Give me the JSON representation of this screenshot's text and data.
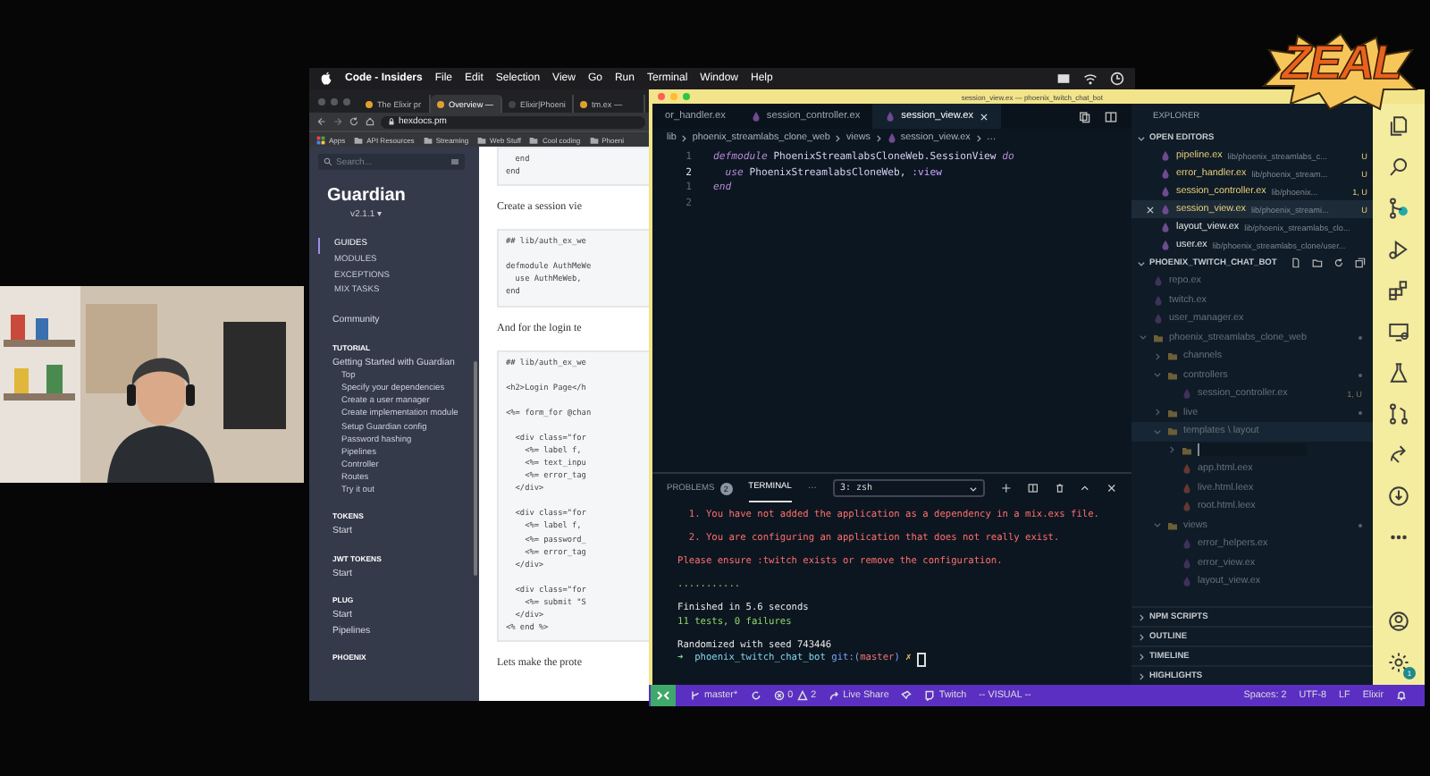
{
  "menu_bar": {
    "app": "Code - Insiders",
    "items": [
      "File",
      "Edit",
      "Selection",
      "View",
      "Go",
      "Run",
      "Terminal",
      "Window",
      "Help"
    ]
  },
  "logo": {
    "text": "ZEAL"
  },
  "browser": {
    "tabs": [
      {
        "title": "The Elixir pr",
        "selected": false
      },
      {
        "title": "Overview —",
        "selected": true
      },
      {
        "title": "Elixir|Phoeni",
        "selected": false
      },
      {
        "title": "tm.ex —",
        "selected": false
      }
    ],
    "url": "hexdocs.pm",
    "bookmarks": [
      {
        "label": "Apps",
        "kind": "apps"
      },
      {
        "label": "API Resources",
        "kind": "folder"
      },
      {
        "label": "Streaming",
        "kind": "folder"
      },
      {
        "label": "Web Stuff",
        "kind": "folder"
      },
      {
        "label": "Cool coding",
        "kind": "folder"
      },
      {
        "label": "Phoeni",
        "kind": "folder"
      }
    ],
    "sidebar": {
      "search_placeholder": "Search...",
      "title": "Guardian",
      "version": "v2.1.1 ▾",
      "nav": [
        {
          "label": "GUIDES",
          "selected": true
        },
        {
          "label": "MODULES",
          "selected": false
        },
        {
          "label": "EXCEPTIONS",
          "selected": false
        },
        {
          "label": "MIX TASKS",
          "selected": false
        }
      ],
      "sections": [
        {
          "items": [
            {
              "label": "Community"
            }
          ]
        },
        {
          "heading": "TUTORIAL",
          "items": [
            {
              "label": "Getting Started with Guardian",
              "children": [
                {
                  "label": "Top"
                },
                {
                  "label": "Specify your dependencies"
                },
                {
                  "label": "Create a user manager"
                },
                {
                  "label": "Create implementation module"
                },
                {
                  "label": "Setup Guardian config"
                },
                {
                  "label": "Password hashing"
                },
                {
                  "label": "Pipelines"
                },
                {
                  "label": "Controller"
                },
                {
                  "label": "Routes"
                },
                {
                  "label": "Try it out"
                }
              ]
            }
          ]
        },
        {
          "heading": "TOKENS",
          "items": [
            {
              "label": "Start"
            }
          ]
        },
        {
          "heading": "JWT TOKENS",
          "items": [
            {
              "label": "Start"
            }
          ]
        },
        {
          "heading": "PLUG",
          "items": [
            {
              "label": "Start"
            },
            {
              "label": "Pipelines"
            }
          ]
        },
        {
          "heading": "PHOENIX"
        }
      ]
    },
    "content": [
      {
        "kind": "code",
        "groups": [
          [
            "  end",
            "end"
          ]
        ]
      },
      {
        "kind": "text",
        "text": "Create a session vie"
      },
      {
        "kind": "code",
        "groups": [
          [
            "## lib/auth_ex_we"
          ],
          [
            "defmodule AuthMeWe",
            "  use AuthMeWeb,",
            "end"
          ]
        ]
      },
      {
        "kind": "text",
        "text": "And for the login te"
      },
      {
        "kind": "code",
        "groups": [
          [
            "## lib/auth_ex_we"
          ],
          [
            "<h2>Login Page</h"
          ],
          [
            "<%= form_for @chan"
          ],
          [
            "  <div class=\"for",
            "    <%= label f,",
            "    <%= text_inpu",
            "    <%= error_tag",
            "  </div>"
          ],
          [
            "  <div class=\"for",
            "    <%= label f,",
            "    <%= password_",
            "    <%= error_tag",
            "  </div>"
          ],
          [
            "  <div class=\"for",
            "    <%= submit \"S",
            "  </div>",
            "<% end %>"
          ]
        ]
      },
      {
        "kind": "text",
        "text": "Lets make the prote"
      }
    ]
  },
  "editor": {
    "title": "session_view.ex — phoenix_twitch_chat_bot",
    "tabs": [
      {
        "label": "or_handler.ex",
        "selected": false
      },
      {
        "label": "session_controller.ex",
        "selected": false
      },
      {
        "label": "session_view.ex",
        "selected": true
      }
    ],
    "breadcrumb": [
      "lib",
      "phoenix_streamlabs_clone_web",
      "views",
      "session_view.ex",
      "…"
    ],
    "lines": [
      {
        "number": "1",
        "current": false,
        "tokens": [
          {
            "text": "defmodule",
            "kind": "keyword"
          },
          {
            "text": "PhoenixStreamlabsCloneWeb.SessionView",
            "kind": "module"
          },
          {
            "text": "do",
            "kind": "keyword"
          }
        ]
      },
      {
        "number": "2",
        "current": true,
        "tokens": [
          {
            "text": "  use",
            "kind": "keyword"
          },
          {
            "text": "PhoenixStreamlabsCloneWeb,",
            "kind": "module"
          },
          {
            "text": ":view",
            "kind": "atom"
          }
        ]
      },
      {
        "number": "1",
        "current": false,
        "tokens": [
          {
            "text": "end",
            "kind": "keyword"
          }
        ]
      },
      {
        "number": "2",
        "current": false
      }
    ],
    "panel": {
      "tabs": [
        {
          "label": "PROBLEMS",
          "badge": "2",
          "selected": false
        },
        {
          "label": "TERMINAL",
          "selected": true
        }
      ],
      "more": "···",
      "terminal_select": "3: zsh",
      "blocks": [
        [
          {
            "kind": "error",
            "text": "  1. You have not added the application as a dependency in a mix.exs file."
          }
        ],
        [
          {
            "kind": "error",
            "text": "  2. You are configuring an application that does not really exist."
          }
        ],
        [
          {
            "kind": "error",
            "text": "Please ensure :twitch exists or remove the configuration."
          }
        ],
        [
          {
            "kind": "success",
            "text": "..........."
          }
        ],
        [
          {
            "kind": "plain",
            "text": "Finished in 5.6 seconds"
          },
          {
            "kind": "success",
            "text": "11 tests, 0 failures"
          }
        ],
        [
          {
            "kind": "plain",
            "text": "Randomized with seed 743446"
          },
          {
            "kind": "prompt",
            "tokens": [
              {
                "text": "➜  ",
                "kind": "arrow"
              },
              {
                "text": "phoenix_twitch_chat_bot ",
                "kind": "dir"
              },
              {
                "text": "git:(",
                "kind": "git"
              },
              {
                "text": "master",
                "kind": "branch"
              },
              {
                "text": ") ",
                "kind": "git"
              },
              {
                "text": "✗",
                "kind": "dirty"
              }
            ]
          }
        ]
      ]
    }
  },
  "explorer": {
    "title": "EXPLORER",
    "open_editors_title": "OPEN EDITORS",
    "open_editors": [
      {
        "name": "pipeline.ex",
        "path": "lib/phoenix_streamlabs_c...",
        "status": "U",
        "selected": false
      },
      {
        "name": "error_handler.ex",
        "path": "lib/phoenix_stream...",
        "status": "U",
        "selected": false
      },
      {
        "name": "session_controller.ex",
        "path": "lib/phoenix...",
        "status": "1, U",
        "selected": false
      },
      {
        "name": "session_view.ex",
        "path": "lib/phoenix_streami...",
        "status": "U",
        "selected": true
      },
      {
        "name": "layout_view.ex",
        "path": "lib/phoenix_streamlabs_clo...",
        "selected": false
      },
      {
        "name": "user.ex",
        "path": "lib/phoenix_streamlabs_clone/user...",
        "selected": false
      }
    ],
    "root": "PHOENIX_TWITCH_CHAT_BOT",
    "tree": [
      {
        "name": "repo.ex",
        "kind": "elixir",
        "selected": false
      },
      {
        "name": "twitch.ex",
        "kind": "elixir",
        "selected": false
      },
      {
        "name": "user_manager.ex",
        "kind": "elixir",
        "selected": false
      },
      {
        "name": "phoenix_streamlabs_clone_web",
        "kind": "folder",
        "expanded": true,
        "modified": true,
        "selected": false,
        "children": [
          {
            "name": "channels",
            "kind": "folder",
            "expanded": false,
            "modified": false,
            "selected": false
          },
          {
            "name": "controllers",
            "kind": "folder",
            "expanded": true,
            "modified": true,
            "selected": false,
            "children": [
              {
                "name": "session_controller.ex",
                "kind": "elixir",
                "status": "1, U",
                "selected": false
              }
            ]
          },
          {
            "name": "live",
            "kind": "folder",
            "expanded": false,
            "modified": true,
            "selected": false
          },
          {
            "name": "templates \\ layout",
            "kind": "folder",
            "expanded": true,
            "modified": false,
            "selected": true,
            "children": [
              {
                "kind": "new-folder",
                "expanded": false,
                "selected": false
              },
              {
                "name": "app.html.eex",
                "kind": "eex",
                "selected": false
              },
              {
                "name": "live.html.leex",
                "kind": "eex",
                "selected": false
              },
              {
                "name": "root.html.leex",
                "kind": "eex",
                "selected": false
              }
            ]
          },
          {
            "name": "views",
            "kind": "folder",
            "expanded": true,
            "modified": true,
            "selected": false,
            "children": [
              {
                "name": "error_helpers.ex",
                "kind": "elixir",
                "selected": false
              },
              {
                "name": "error_view.ex",
                "kind": "elixir",
                "selected": false
              },
              {
                "name": "layout_view.ex",
                "kind": "elixir",
                "selected": false
              }
            ]
          }
        ]
      }
    ],
    "sections": [
      {
        "label": "NPM SCRIPTS",
        "expanded": false
      },
      {
        "label": "OUTLINE",
        "expanded": false
      },
      {
        "label": "TIMELINE",
        "expanded": false
      },
      {
        "label": "HIGHLIGHTS",
        "expanded": false
      }
    ]
  },
  "activity_bar": {
    "settings_badge": "1"
  },
  "status_bar": {
    "branch": "master*",
    "errors": "0",
    "warnings": "2",
    "live_share": "Live Share",
    "twitch": "Twitch",
    "mode": "-- VISUAL --",
    "right": [
      "Spaces: 2",
      "UTF-8",
      "LF",
      "Elixir"
    ]
  }
}
